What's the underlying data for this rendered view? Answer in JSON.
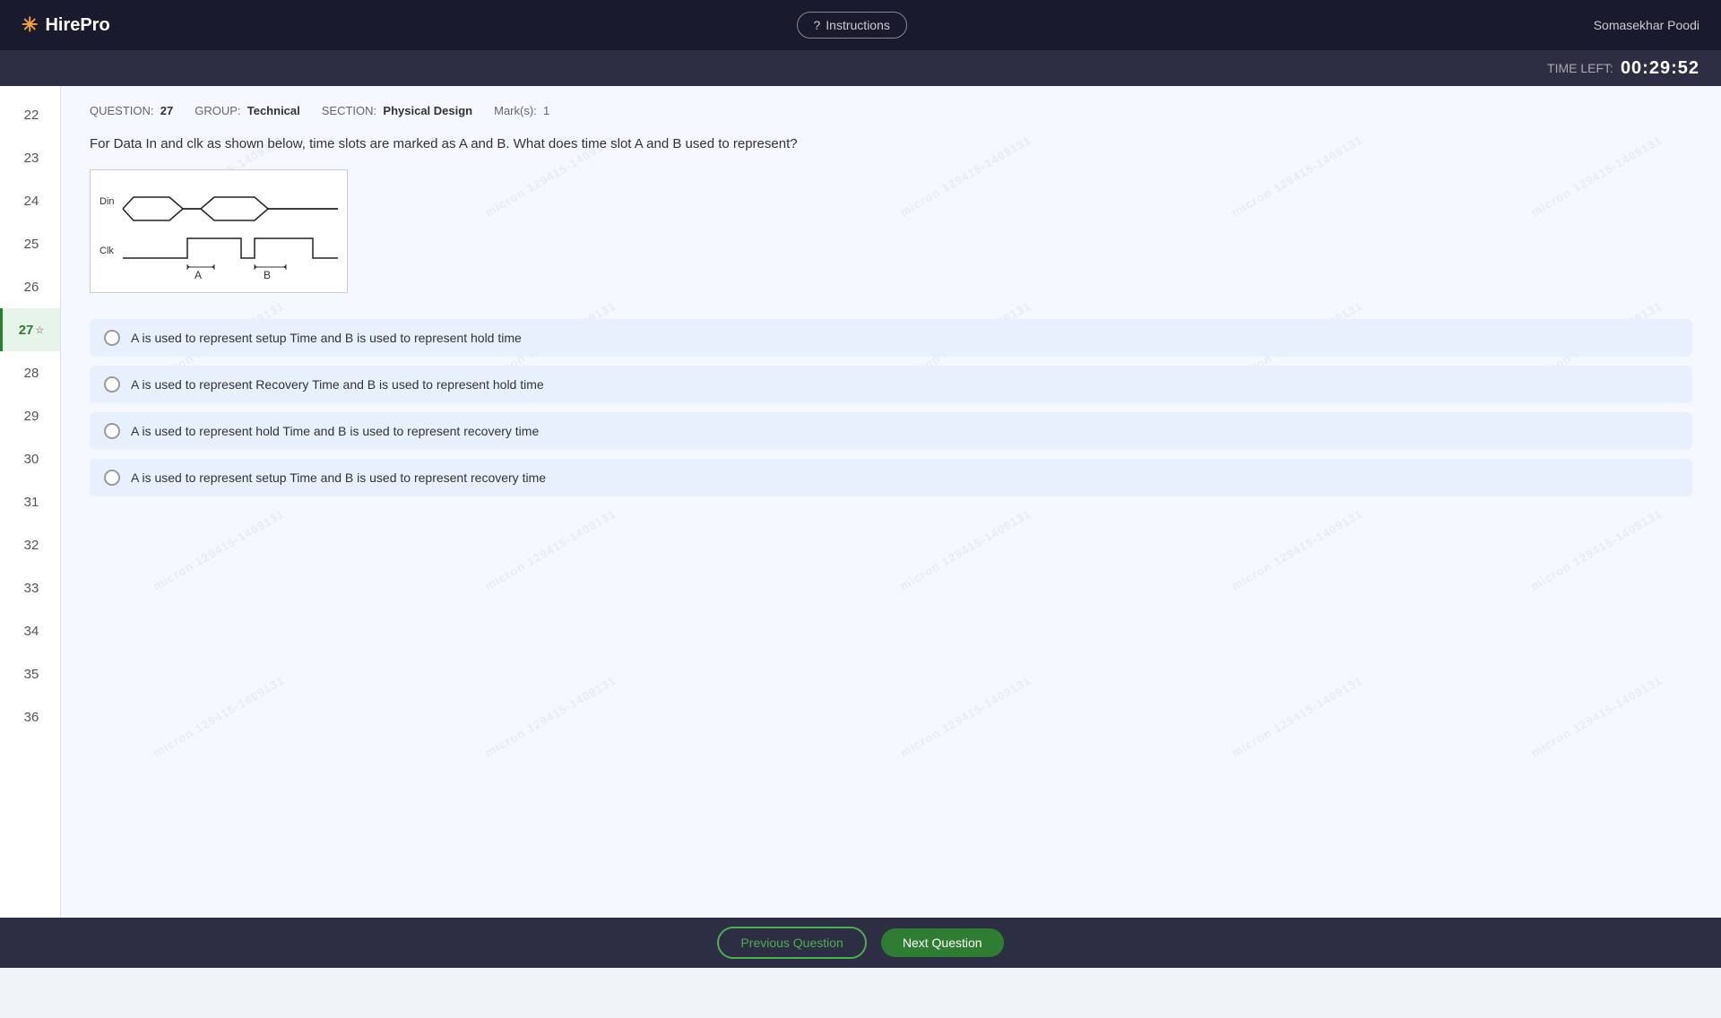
{
  "header": {
    "logo_text": "HirePro",
    "instructions_label": "Instructions",
    "user_name": "Somasekhar Poodi"
  },
  "timer": {
    "label": "TIME LEFT:",
    "value": "00:29:52"
  },
  "sidebar": {
    "items": [
      {
        "number": "22",
        "state": "normal"
      },
      {
        "number": "23",
        "state": "normal"
      },
      {
        "number": "24",
        "state": "normal"
      },
      {
        "number": "25",
        "state": "normal"
      },
      {
        "number": "26",
        "state": "normal"
      },
      {
        "number": "27",
        "state": "current",
        "starred": true
      },
      {
        "number": "28",
        "state": "normal"
      },
      {
        "number": "29",
        "state": "normal"
      },
      {
        "number": "30",
        "state": "normal"
      },
      {
        "number": "31",
        "state": "normal"
      },
      {
        "number": "32",
        "state": "normal"
      },
      {
        "number": "33",
        "state": "normal"
      },
      {
        "number": "34",
        "state": "normal"
      },
      {
        "number": "35",
        "state": "normal"
      },
      {
        "number": "36",
        "state": "normal"
      }
    ]
  },
  "question": {
    "number": "27",
    "group": "Technical",
    "section": "Physical Design",
    "marks": "1",
    "text": "For Data In and clk as shown below, time slots are marked as A and B. What does time slot A and B used to represent?",
    "options": [
      {
        "id": "opt1",
        "text": "A is used to represent  setup Time and B is used to represent hold time"
      },
      {
        "id": "opt2",
        "text": "A is used to represent Recovery Time and B is used to represent hold time"
      },
      {
        "id": "opt3",
        "text": "A is used to represent  hold Time and B is used to represent recovery time"
      },
      {
        "id": "opt4",
        "text": "A is used to represent  setup Time and B is used to represent recovery time"
      }
    ]
  },
  "meta_labels": {
    "question_label": "QUESTION:",
    "group_label": "GROUP:",
    "section_label": "SECTION:",
    "marks_label": "Mark(s):"
  },
  "nav": {
    "prev_label": "Previous Question",
    "next_label": "Next Question"
  },
  "watermark": {
    "text": "micron 129415-1409131"
  }
}
